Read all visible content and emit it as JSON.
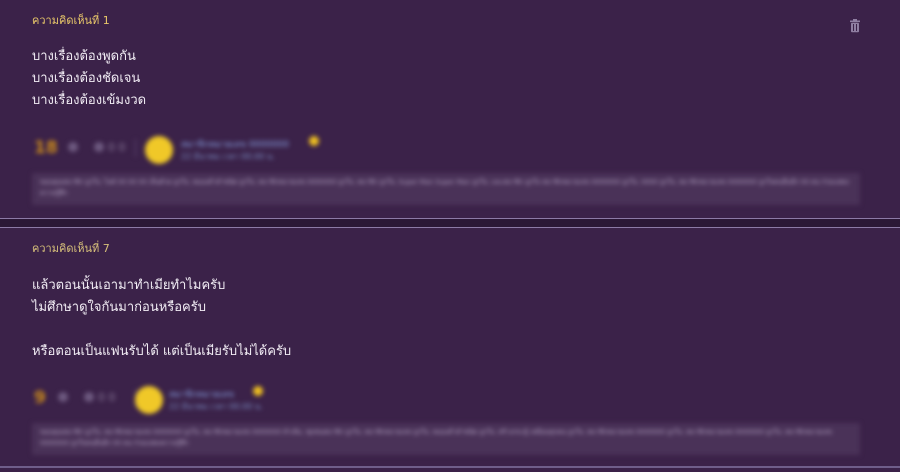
{
  "comments": [
    {
      "number_label": "ความคิดเห็นที่ 1",
      "body_lines": [
        "บางเรื่องต้องพูดกัน",
        "บางเรื่องต้องชัดเจน",
        "บางเรื่องต้องเข้มงวด"
      ],
      "vote_count": "18",
      "emotion_count": "0 0",
      "username": "สมาชิกหมายเลข 0000000",
      "meta": "22 มีนาคม เวลา 00.00 น.",
      "reactions": "ขอบคุณสมาชิก ถูกใจ, ไลค์ 00 00 00 เห็นด้วย ถูกใจ, หมองค่ำคำชนิด ถูกใจ, สมาชิกหมายเลข 0000000 ถูกใจ, สมาชิก ถูกใจ, Super Man Super Man ถูกใจ, และสมาชิก ถูกใจ สมาชิกหมายเลข 0000000 ถูกใจ, 0000 ถูกใจ, สมาชิกหมายเลข 0000000 ถูกใจคนอื่นอีก 00 คน ร่วมแสดงความรู้สึก",
      "accent": "#e9c86a"
    },
    {
      "number_label": "ความคิดเห็นที่ 7",
      "body_lines": [
        "แล้วตอนนั้นเอามาทำเมียทำไมครับ",
        "ไม่ศึกษาดูใจกันมาก่อนหรือครับ",
        "",
        "หรือตอนเป็นแฟนรับได้ แต่เป็นเมียรับไม่ได้ครับ"
      ],
      "vote_count": "9",
      "emotion_count": "0 0",
      "username": "สมาชิกหมายเลข",
      "meta": "22 มีนาคม เวลา 00.00 น.",
      "reactions": "ขอบคุณสมาชิก ถูกใจ, สมาชิกหมายเลข 0000000 ถูกใจ, สมาชิกหมายเลข 0000000 ทำเลิ่ม, ชุมชนสมาชิก ถูกใจ, สมาชิกหมายเลข ถูกใจ, หมองค่ำคำชนิด ถูกใจ, สร้างกระทู้ เหมือนทุกคน ถูกใจ, สมาชิกหมายเลข 0000000 ถูกใจ, สมาชิกหมายเลข 0000000 ถูกใจ, สมาชิกหมายเลข 0000000 ถูกใจคนอื่นอีก 00 คน ร่วมแสดงความรู้สึก",
      "accent": "#d7c07a"
    }
  ],
  "icons": {
    "delete": "trash-icon",
    "vote": "plus-icon",
    "emotion": "emotion-icon",
    "badge": "star-badge-icon"
  },
  "colors": {
    "background": "#3a2148",
    "vote_count": "#c98a1c",
    "avatar": "#f0c828",
    "username": "#8aa6e8"
  }
}
